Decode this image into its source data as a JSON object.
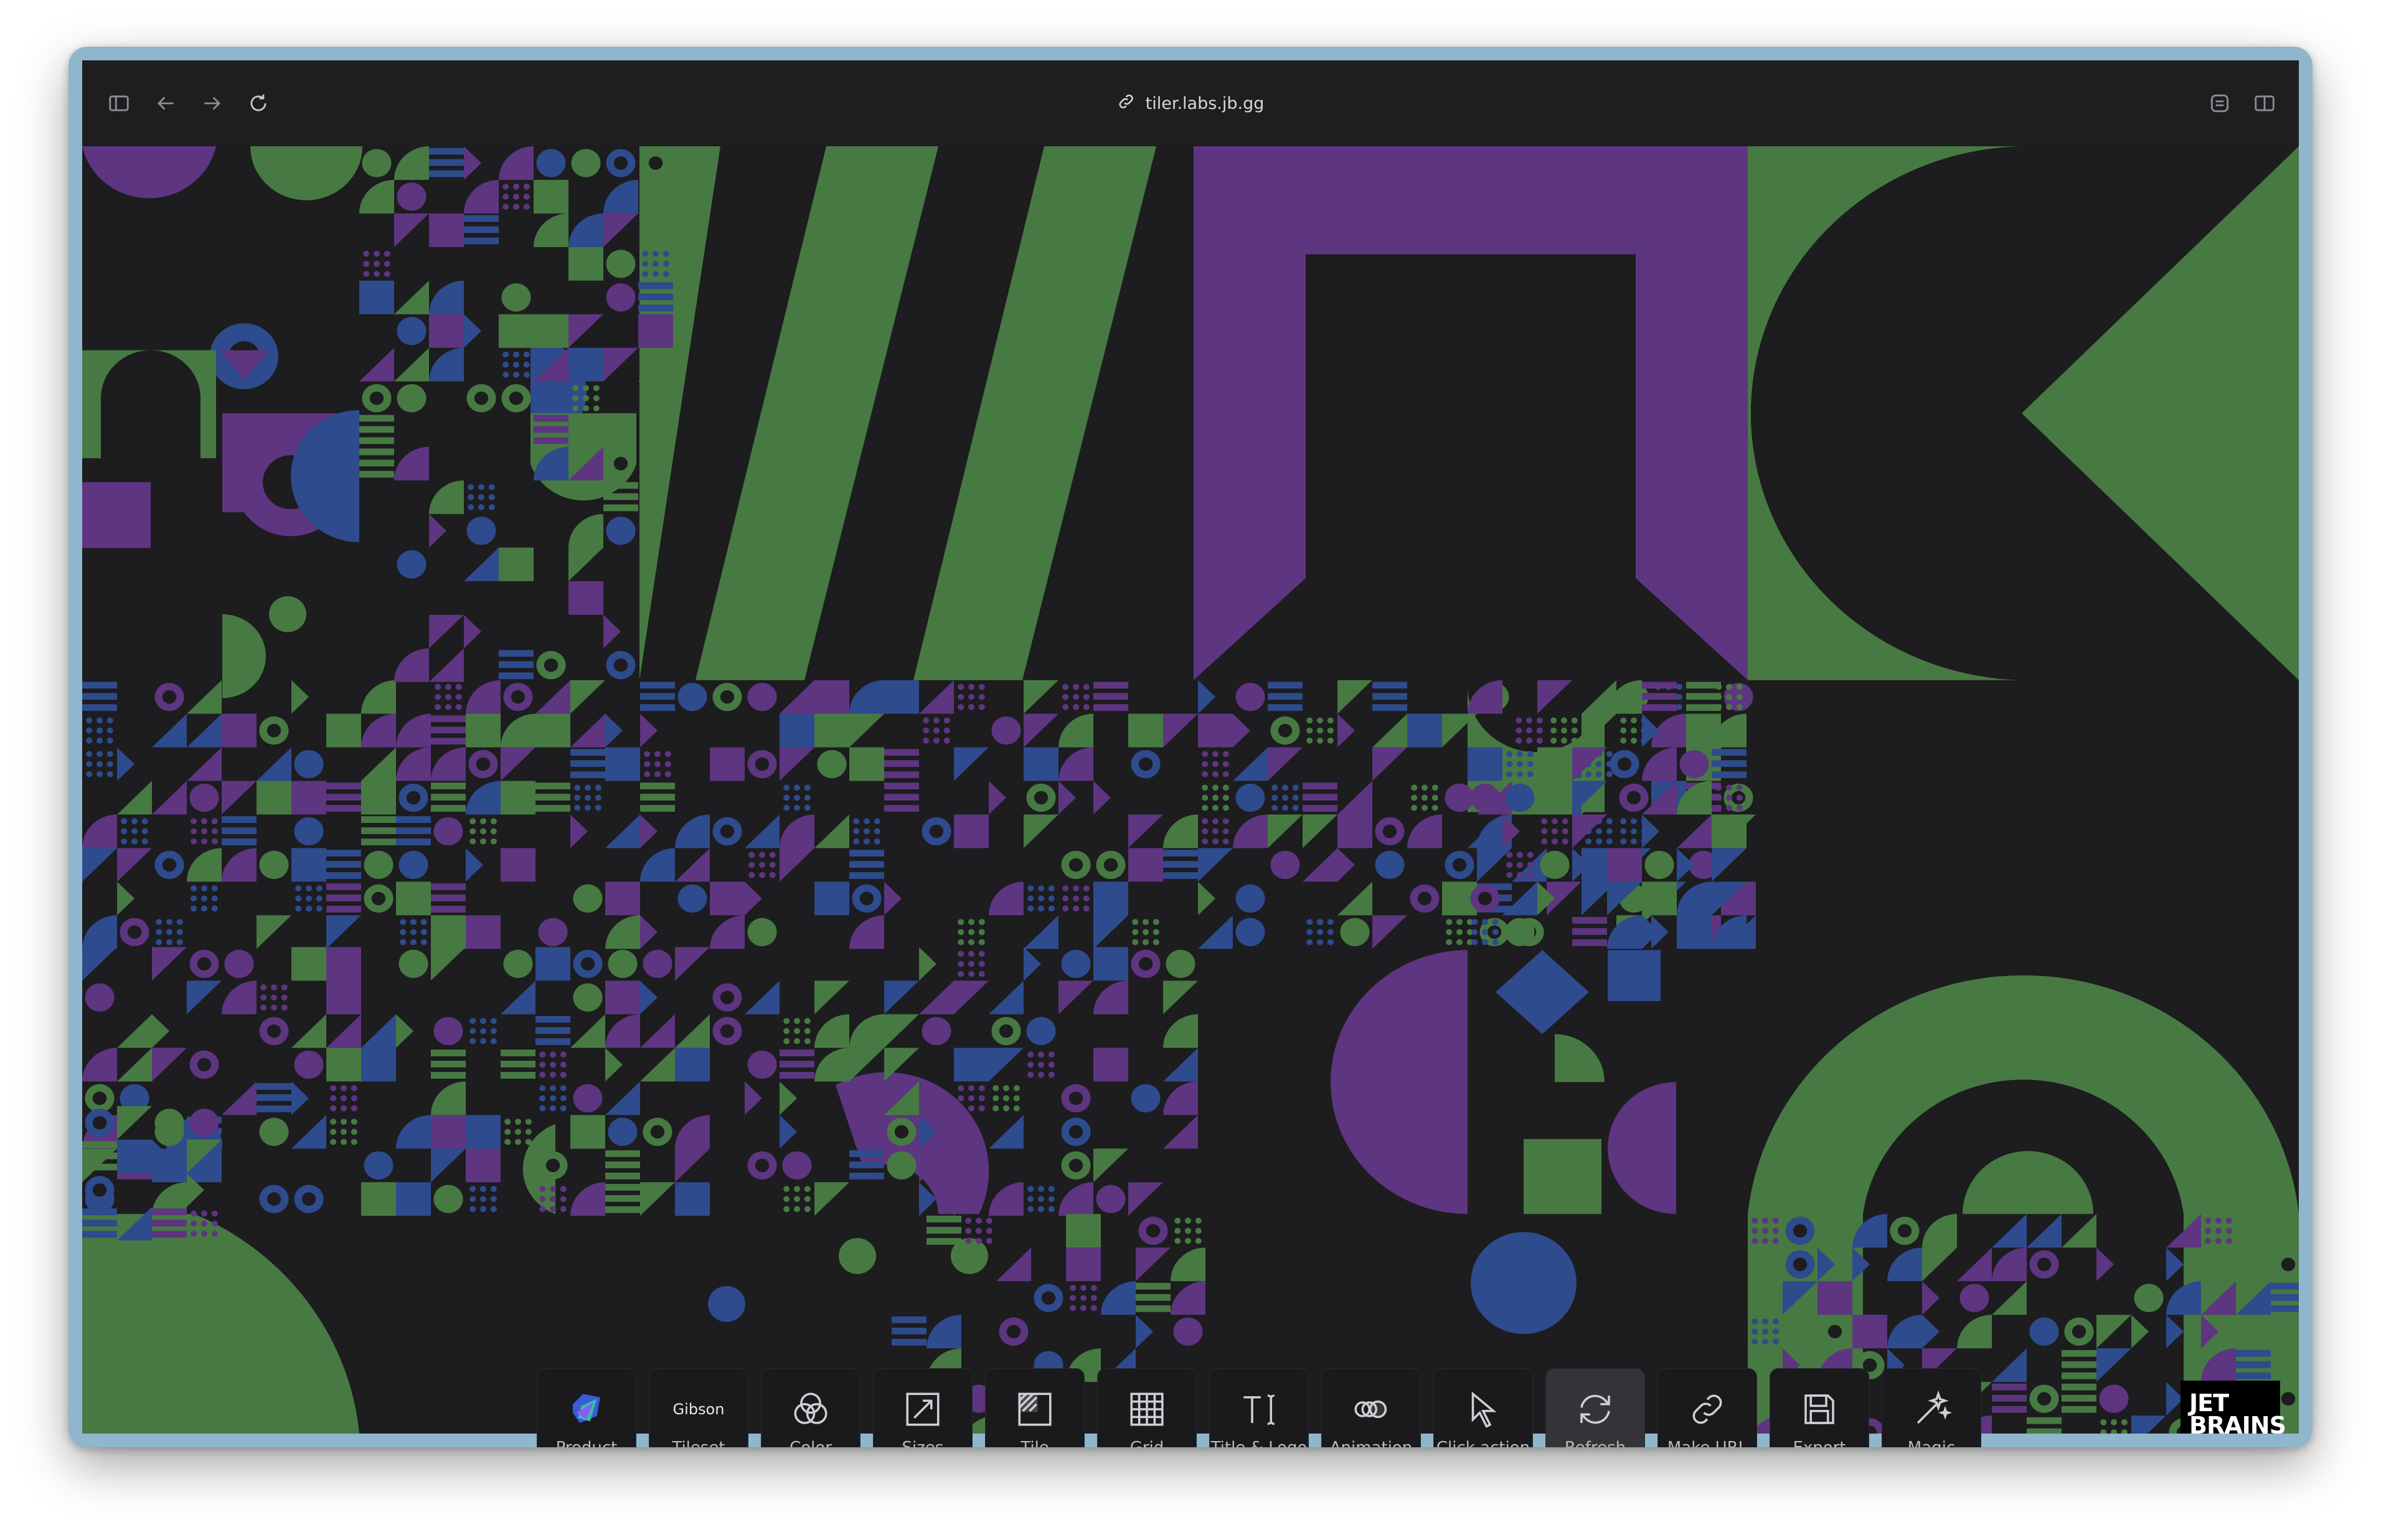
{
  "browser": {
    "url": "tiler.labs.jb.gg"
  },
  "colors": {
    "background": "#1d1c1f",
    "purple": "#5e3580",
    "green": "#477a42",
    "blue": "#2e4b8d"
  },
  "logo": {
    "line1": "JET",
    "line2": "BRAINS"
  },
  "toolbar": {
    "items": [
      {
        "label": "Product",
        "icon": "product-logo-icon"
      },
      {
        "label": "Tileset",
        "icon": "tileset-name",
        "value": "Gibson"
      },
      {
        "label": "Color",
        "icon": "color-circles-icon"
      },
      {
        "label": "Sizes",
        "icon": "resize-icon"
      },
      {
        "label": "Tile",
        "icon": "tile-icon"
      },
      {
        "label": "Grid",
        "icon": "grid-icon"
      },
      {
        "label": "Title & Logo",
        "icon": "text-cursor-icon"
      },
      {
        "label": "Animation",
        "icon": "animation-icon"
      },
      {
        "label": "Click action",
        "icon": "pointer-icon"
      },
      {
        "label": "Refresh",
        "icon": "refresh-icon"
      },
      {
        "label": "Make URL",
        "icon": "link-icon"
      },
      {
        "label": "Export",
        "icon": "save-icon"
      },
      {
        "label": "Magic",
        "icon": "magic-wand-icon"
      }
    ]
  }
}
